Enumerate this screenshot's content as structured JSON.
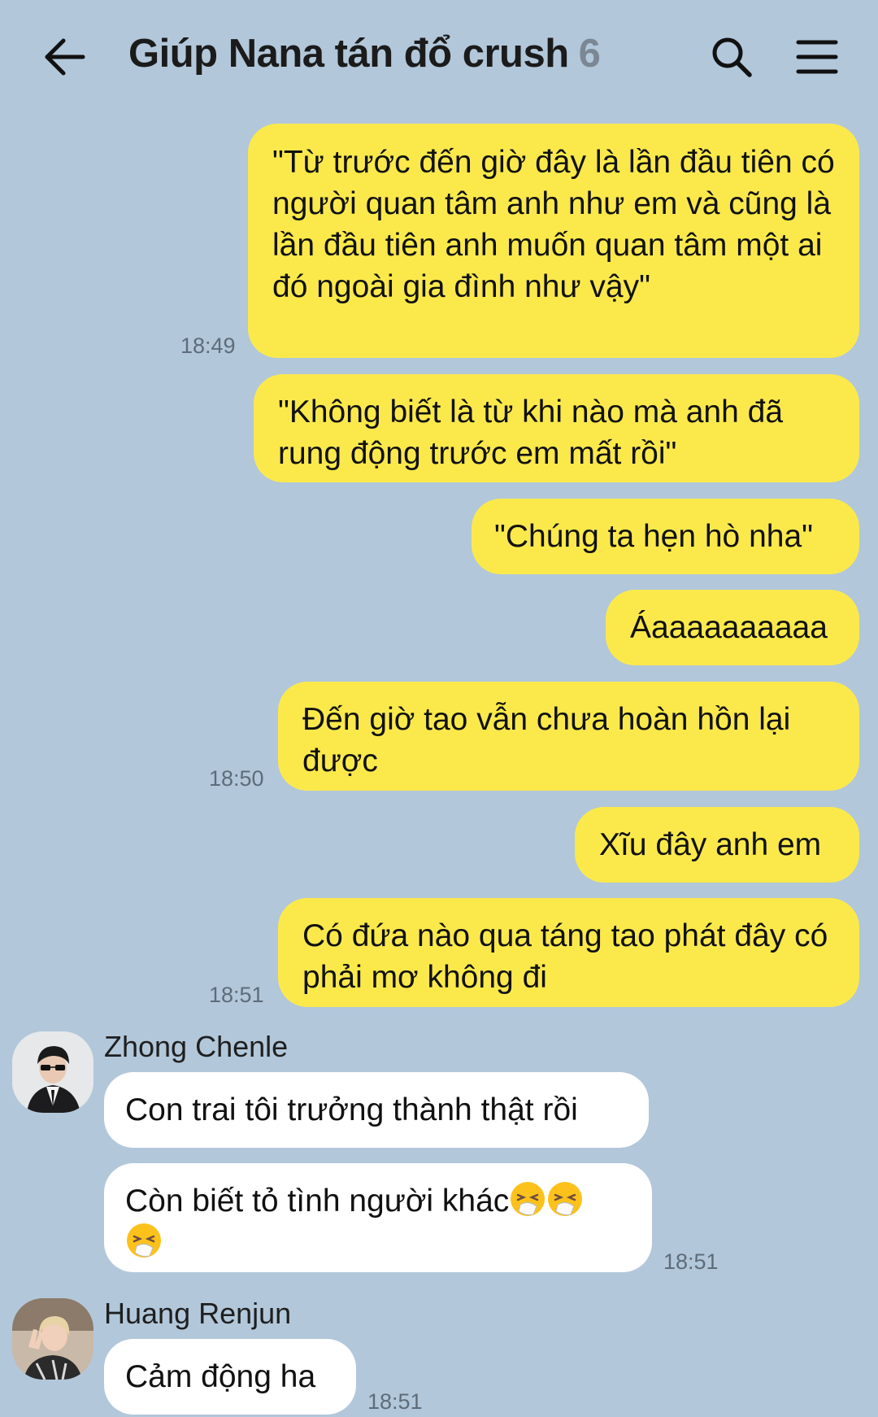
{
  "header": {
    "title": "Giúp Nana tán đổ crush",
    "member_count": "6",
    "icons": [
      "back-arrow-icon",
      "search-icon",
      "menu-icon"
    ]
  },
  "messages": [
    {
      "from": "me",
      "text": "\"Từ trước đến giờ đây là lần đầu tiên có người quan tâm anh như em và cũng là lần đầu tiên anh muốn quan tâm một ai đó ngoài gia đình như vậy\"",
      "time": "18:49"
    },
    {
      "from": "me",
      "text": "\"Không biết là từ khi nào mà anh đã rung động trước em mất rồi\""
    },
    {
      "from": "me",
      "text": "\"Chúng ta hẹn hò nha\""
    },
    {
      "from": "me",
      "text": "Áaaaaaaaaaa"
    },
    {
      "from": "me",
      "text": "Đến giờ tao vẫn chưa hoàn hồn lại được",
      "time": "18:50"
    },
    {
      "from": "me",
      "text": "Xĩu đây anh em"
    },
    {
      "from": "me",
      "text": "Có đứa nào qua táng tao phát đây có phải mơ không đi",
      "time": "18:51"
    },
    {
      "from": "Zhong Chenle",
      "text": "Con trai tôi trưởng thành thật rồi"
    },
    {
      "from": "Zhong Chenle",
      "text": "Còn biết tỏ tình người khác",
      "emoji": "sneezing-face-emoji",
      "time": "18:51"
    },
    {
      "from": "Huang Renjun",
      "text": "Cảm động ha",
      "time": "18:51"
    }
  ],
  "senders": {
    "chenle": "Zhong Chenle",
    "renjun": "Huang Renjun"
  },
  "colors": {
    "background": "#b2c7da",
    "my_bubble": "#fbe94c",
    "their_bubble": "#ffffff",
    "member_count": "#7b8793"
  }
}
